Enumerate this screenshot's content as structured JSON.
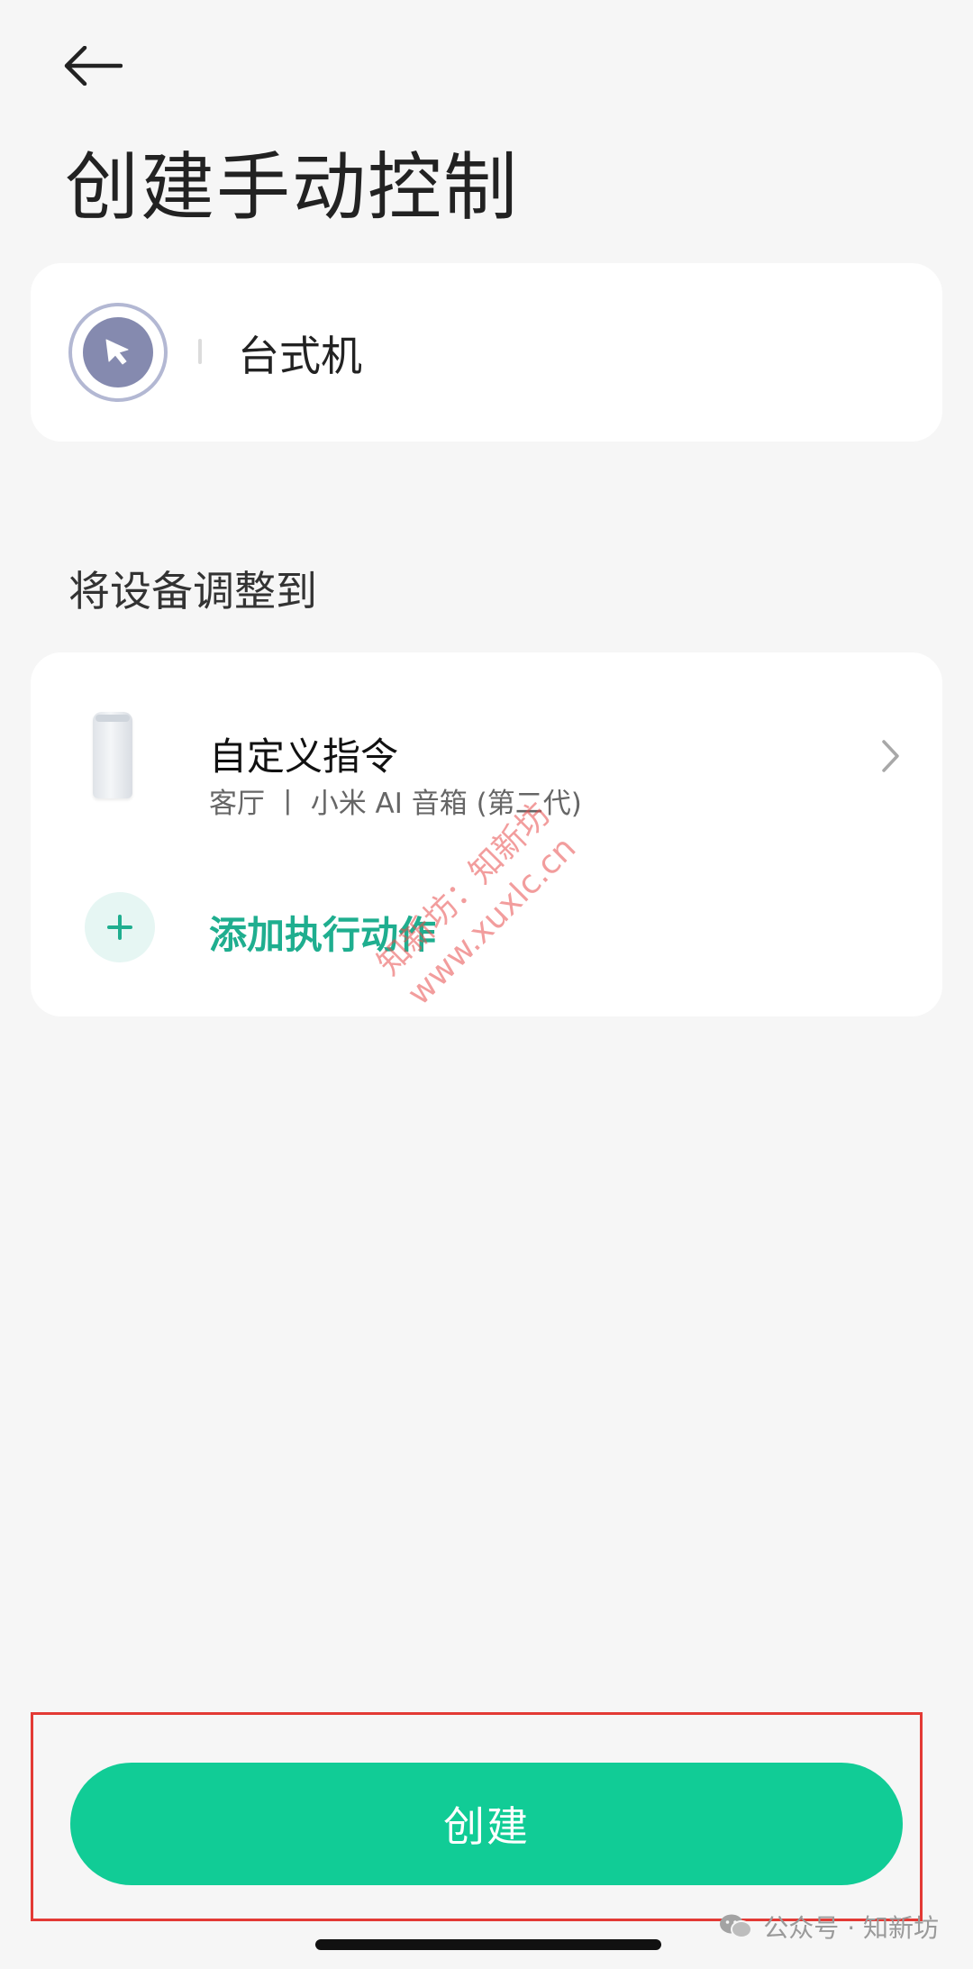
{
  "header": {
    "back_icon": "arrow-left-icon",
    "title": "创建手动控制"
  },
  "scene": {
    "icon": "cursor-arrow-icon",
    "icon_colors": {
      "ring": "#b3b8d3",
      "fill": "#858aaf"
    },
    "name_value": "台式机"
  },
  "section": {
    "heading": "将设备调整到"
  },
  "action": {
    "title": "自定义指令",
    "subtitle": "客厅 丨 小米 AI 音箱 (第二代)",
    "device_icon": "smart-speaker-icon",
    "chevron_icon": "chevron-right-icon"
  },
  "add_action": {
    "icon": "plus-icon",
    "label": "添加执行动作",
    "color": "#1fae8f"
  },
  "watermark": {
    "line1": "知新坊：知新坊",
    "line2": "www.xuxlc.cn"
  },
  "footer": {
    "create_label": "创建",
    "button_color": "#11cc96",
    "highlight_color": "#e33a35"
  },
  "source_tag": {
    "icon": "wechat-icon",
    "text": "公众号 · 知新坊"
  }
}
